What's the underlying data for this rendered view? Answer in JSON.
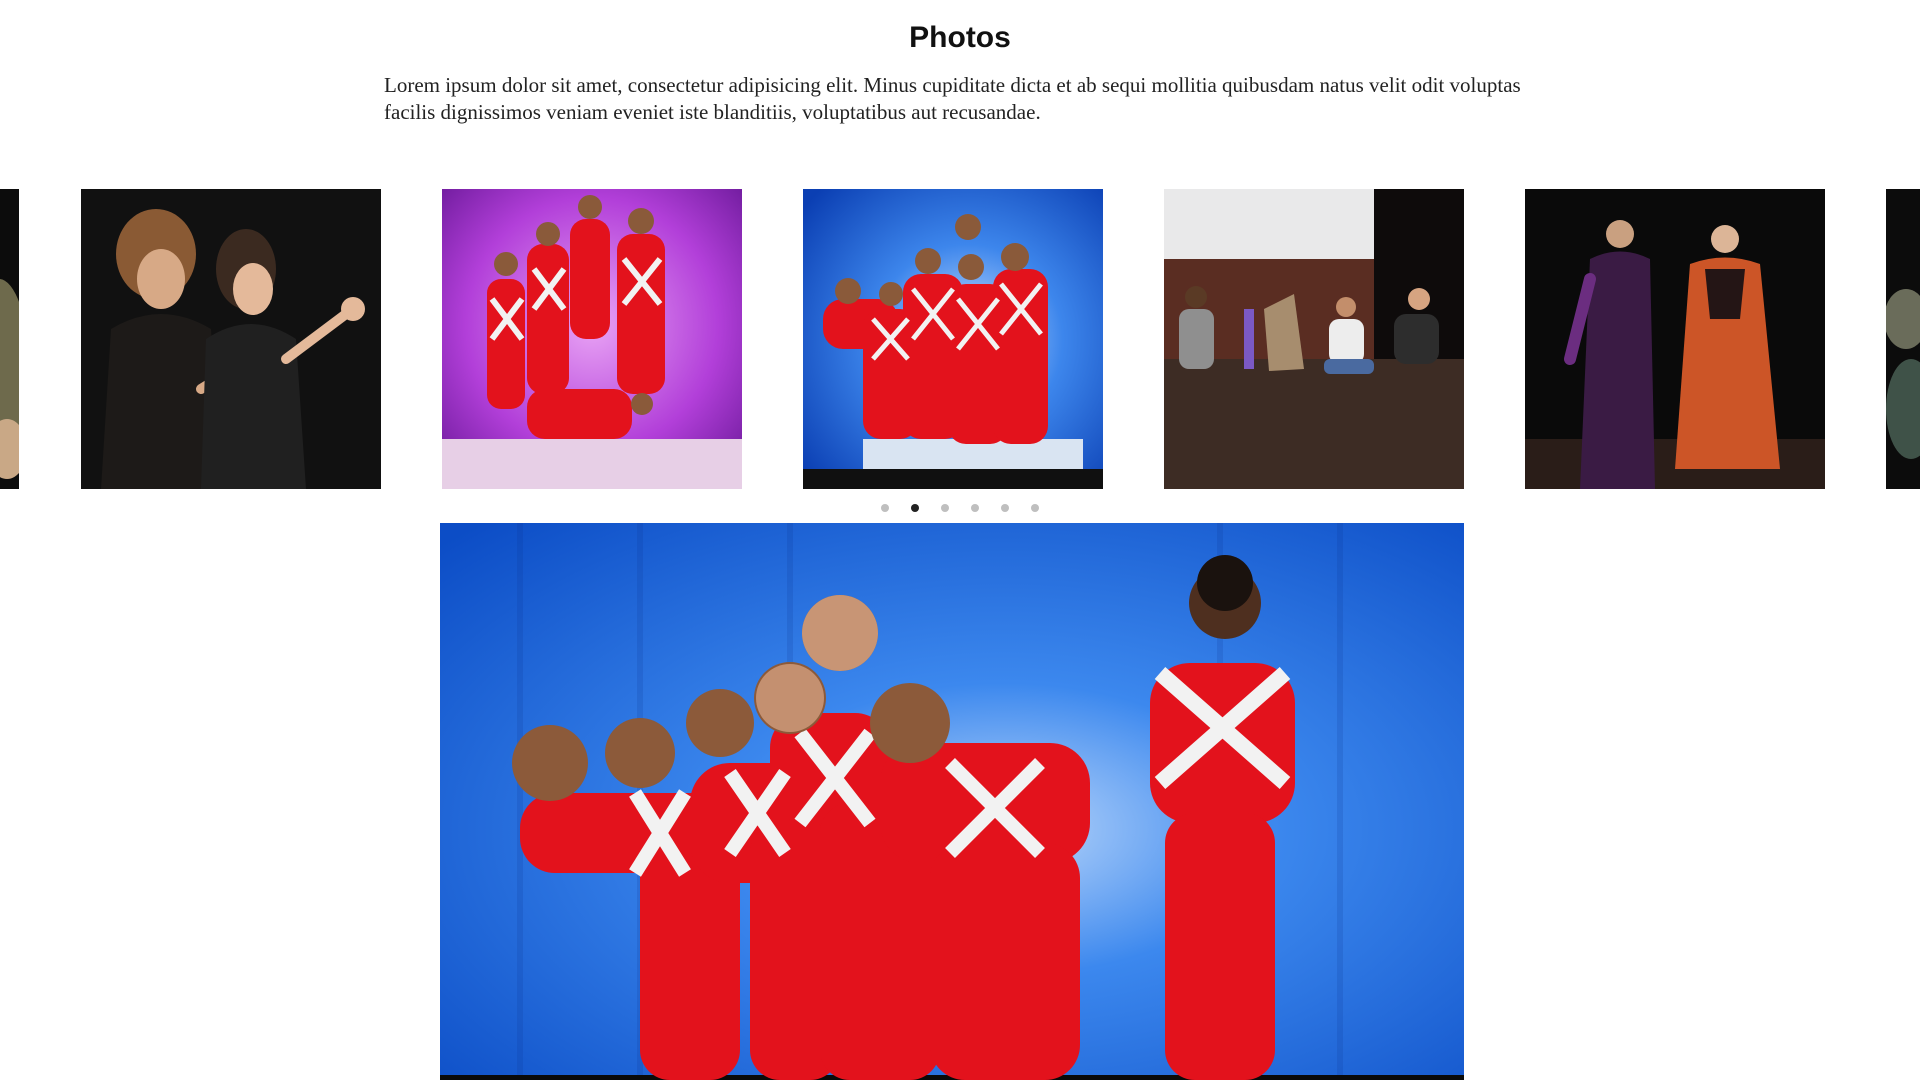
{
  "section": {
    "title": "Photos",
    "intro": "Lorem ipsum dolor sit amet, consectetur adipisicing elit. Minus cupiditate dicta et ab sequi mollitia quibusdam natus velit odit voluptas facilis dignissimos veniam eveniet iste blanditiis, voluptatibus aut recusandae."
  },
  "carousel": {
    "slide_count": 6,
    "active_index": 1
  },
  "colors": {
    "stage_black": "#0b0b0b",
    "costume_red": "#e3121c",
    "backdrop_blue": "#1a63e0",
    "backdrop_purple": "#b23fd9",
    "dot_inactive": "#bfbfbf",
    "dot_active": "#222222"
  }
}
